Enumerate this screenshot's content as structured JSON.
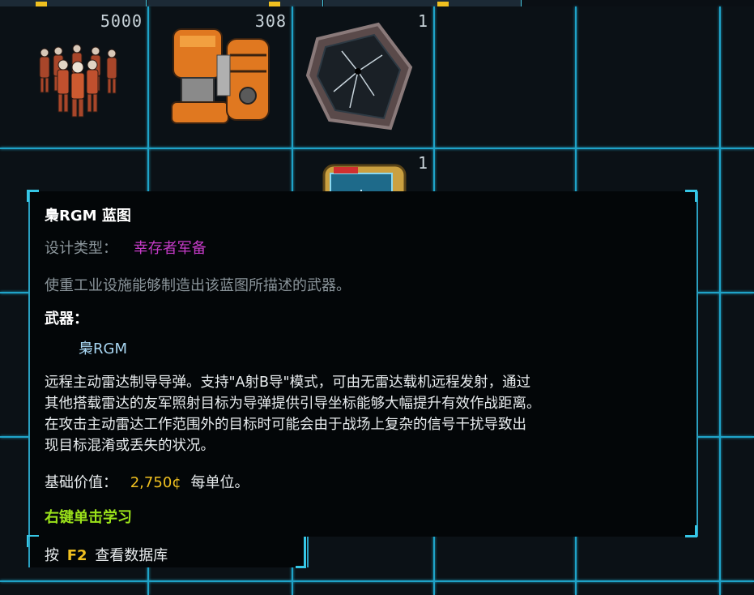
{
  "inventory": {
    "items": [
      {
        "name": "marines-squad",
        "count": "5000"
      },
      {
        "name": "heavy-machinery",
        "count": "308"
      },
      {
        "name": "damaged-armor-plate",
        "count": "1"
      },
      {
        "name": "blueprint-chip",
        "count": "1"
      }
    ]
  },
  "tooltip": {
    "title": "梟RGM 蓝图",
    "design_type_label": "设计类型：",
    "design_type_value": "幸存者军备",
    "description": "使重工业设施能够制造出该蓝图所描述的武器。",
    "weapon_label": "武器：",
    "weapon_name": "梟RGM",
    "weapon_desc_lines": [
      "远程主动雷达制导导弹。支持\"A射B导\"模式，可由无雷达载机远程发射，通过",
      "其他搭载雷达的友军照射目标为导弹提供引导坐标能够大幅提升有效作战距离。",
      "在攻击主动雷达工作范围外的目标时可能会由于战场上复杂的信号干扰导致出",
      "现目标混淆或丢失的状况。"
    ],
    "base_value_label": "基础价值：",
    "base_value_amount": "2,750¢",
    "base_value_unit": "每单位。",
    "action_hint": "右键单击学习",
    "footer_prefix": "按",
    "footer_key": "F2",
    "footer_suffix": "查看数据库"
  },
  "colors": {
    "grid": "#1fa3c8",
    "accent_magenta": "#c63bc8",
    "accent_yellow": "#f0c020",
    "accent_green": "#9be21a",
    "weapon_blue": "#a8d6f2"
  }
}
